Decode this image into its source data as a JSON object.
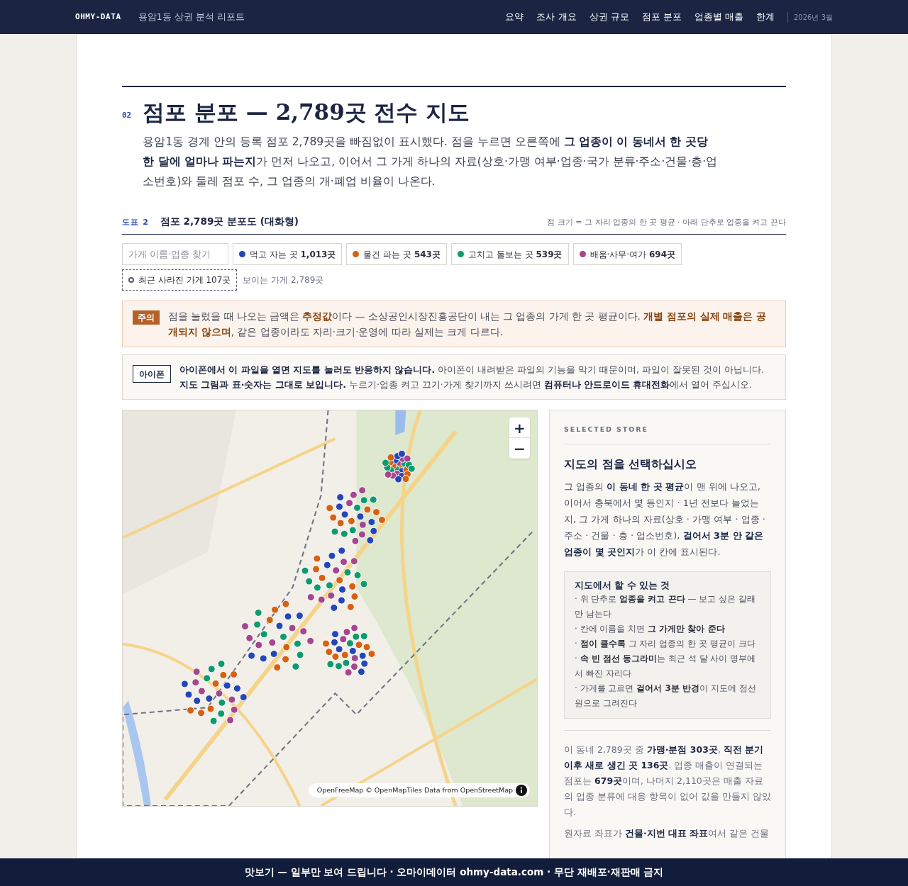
{
  "header": {
    "brand": "OHMY-DATA",
    "title": "용암1동 상권 분석 리포트",
    "nav": [
      {
        "label": "요약",
        "selected": false
      },
      {
        "label": "조사 개요",
        "selected": false
      },
      {
        "label": "상권 규모",
        "selected": false
      },
      {
        "label": "점포 분포",
        "selected": false
      },
      {
        "label": "업종별 매출",
        "selected": false
      },
      {
        "label": "한계",
        "selected": false
      }
    ],
    "date": "2026년 3월"
  },
  "section": {
    "number": "02",
    "title": "점포 분포 — 2,789곳 전수 지도",
    "lead": "용암1동 경계 안의 등록 점포 2,789곳을 빠짐없이 표시했다. 점을 누르면 오른쪽에 **그 업종이 이 동네서 한 곳당 한 달에 얼마나 파는지**가 먼저 나오고, 이어서 그 가게 하나의 자료(상호·가맹 여부·업종·국가 분류·주소·건물·층·업소번호)와 둘레 점포 수, 그 업종의 개·폐업 비율이 나온다."
  },
  "figure": {
    "label": "도표 2",
    "title": "점포 2,789곳 분포도 (대화형)",
    "note": "점 크기 = 그 자리 업종의 한 곳 평균 · 아래 단추로 업종을 켜고 끈다"
  },
  "search": {
    "placeholder": "가게 이름·업종 찾기"
  },
  "filters": [
    {
      "label": "먹고 자는 곳",
      "count": "1,013곳",
      "color": "#2446b8"
    },
    {
      "label": "물건 파는 곳",
      "count": "543곳",
      "color": "#d9600f"
    },
    {
      "label": "고치고 돌보는 곳",
      "count": "539곳",
      "color": "#0f9a6e"
    },
    {
      "label": "배움·사무·여가",
      "count": "694곳",
      "color": "#a6468f"
    }
  ],
  "closed_filter": {
    "label": "최근 사라진 가게 107곳"
  },
  "visible_count": "보이는 가게 2,789곳",
  "caution": {
    "badge": "주의",
    "text": "점을 눌렀을 때 나오는 금액은 **추정값**이다 — 소상공인시장진흥공단이 내는 그 업종의 가게 한 곳 평균이다. **개별 점포의 실제 매출은 공개되지 않으며**, 같은 업종이라도 자리·크기·운영에 따라 실제는 크게 다르다."
  },
  "iphone": {
    "badge": "아이폰",
    "text": "**아이폰에서 이 파일을 열면 지도를 눌러도 반응하지 않습니다.** 아이폰이 내려받은 파일의 기능을 막기 때문이며, 파일이 잘못된 것이 아닙니다. **지도 그림과 표·숫자는 그대로 보입니다.** 누르기·업종 켜고 끄기·가게 찾기까지 쓰시려면 **컴퓨터나 안드로이드 휴대전화**에서 열어 주십시오."
  },
  "map": {
    "kind": "picture",
    "zoom_in": "+",
    "zoom_out": "−",
    "attribution": "OpenFreeMap © OpenMapTiles Data from OpenStreetMap"
  },
  "panel": {
    "eyebrow": "SELECTED STORE",
    "title": "지도의 점을 선택하십시오",
    "intro": "그 업종의 **이 동네 한 곳 평균**이 맨 위에 나오고, 이어서 충북에서 몇 등인지 · 1년 전보다 늘었는지, 그 가게 하나의 자료(상호 · 가맹 여부 · 업종 · 주소 · 건물 · 층 · 업소번호), **걸어서 3분 안 같은 업종이 몇 곳인지**가 이 칸에 표시된다.",
    "howto_title": "지도에서 할 수 있는 것",
    "howto": [
      "· 위 단추로 **업종을 켜고 끈다** — 보고 싶은 갈래만 남는다",
      "· 칸에 이름을 치면 **그 가게만 찾아 준다**",
      "· **점이 클수록** 그 자리 업종의 한 곳 평균이 크다",
      "· **속 빈 점선 동그라미**는 최근 석 달 사이 명부에서 빠진 자리다",
      "· 가게를 고르면 **걸어서 3분 반경**이 지도에 점선 원으로 그려진다"
    ],
    "stats": "이 동네 2,789곳 중 **가맹·분점 303곳**, **직전 분기 이후 새로 생긴 곳 136곳**. 업종 매출이 연결되는 점포는 **679곳**이며, 나머지 2,110곳은 매출 자료의 업종 분류에 대응 항목이 없어 값을 만들지 않았다.",
    "source": "원자료 좌표가 **건물·지번 대표 좌표**여서 같은 건물"
  },
  "footer": "맛보기 — 일부만 보여 드립니다 · 오마이데이터 ohmy-data.com · 무단 재배포·재판매 금지"
}
